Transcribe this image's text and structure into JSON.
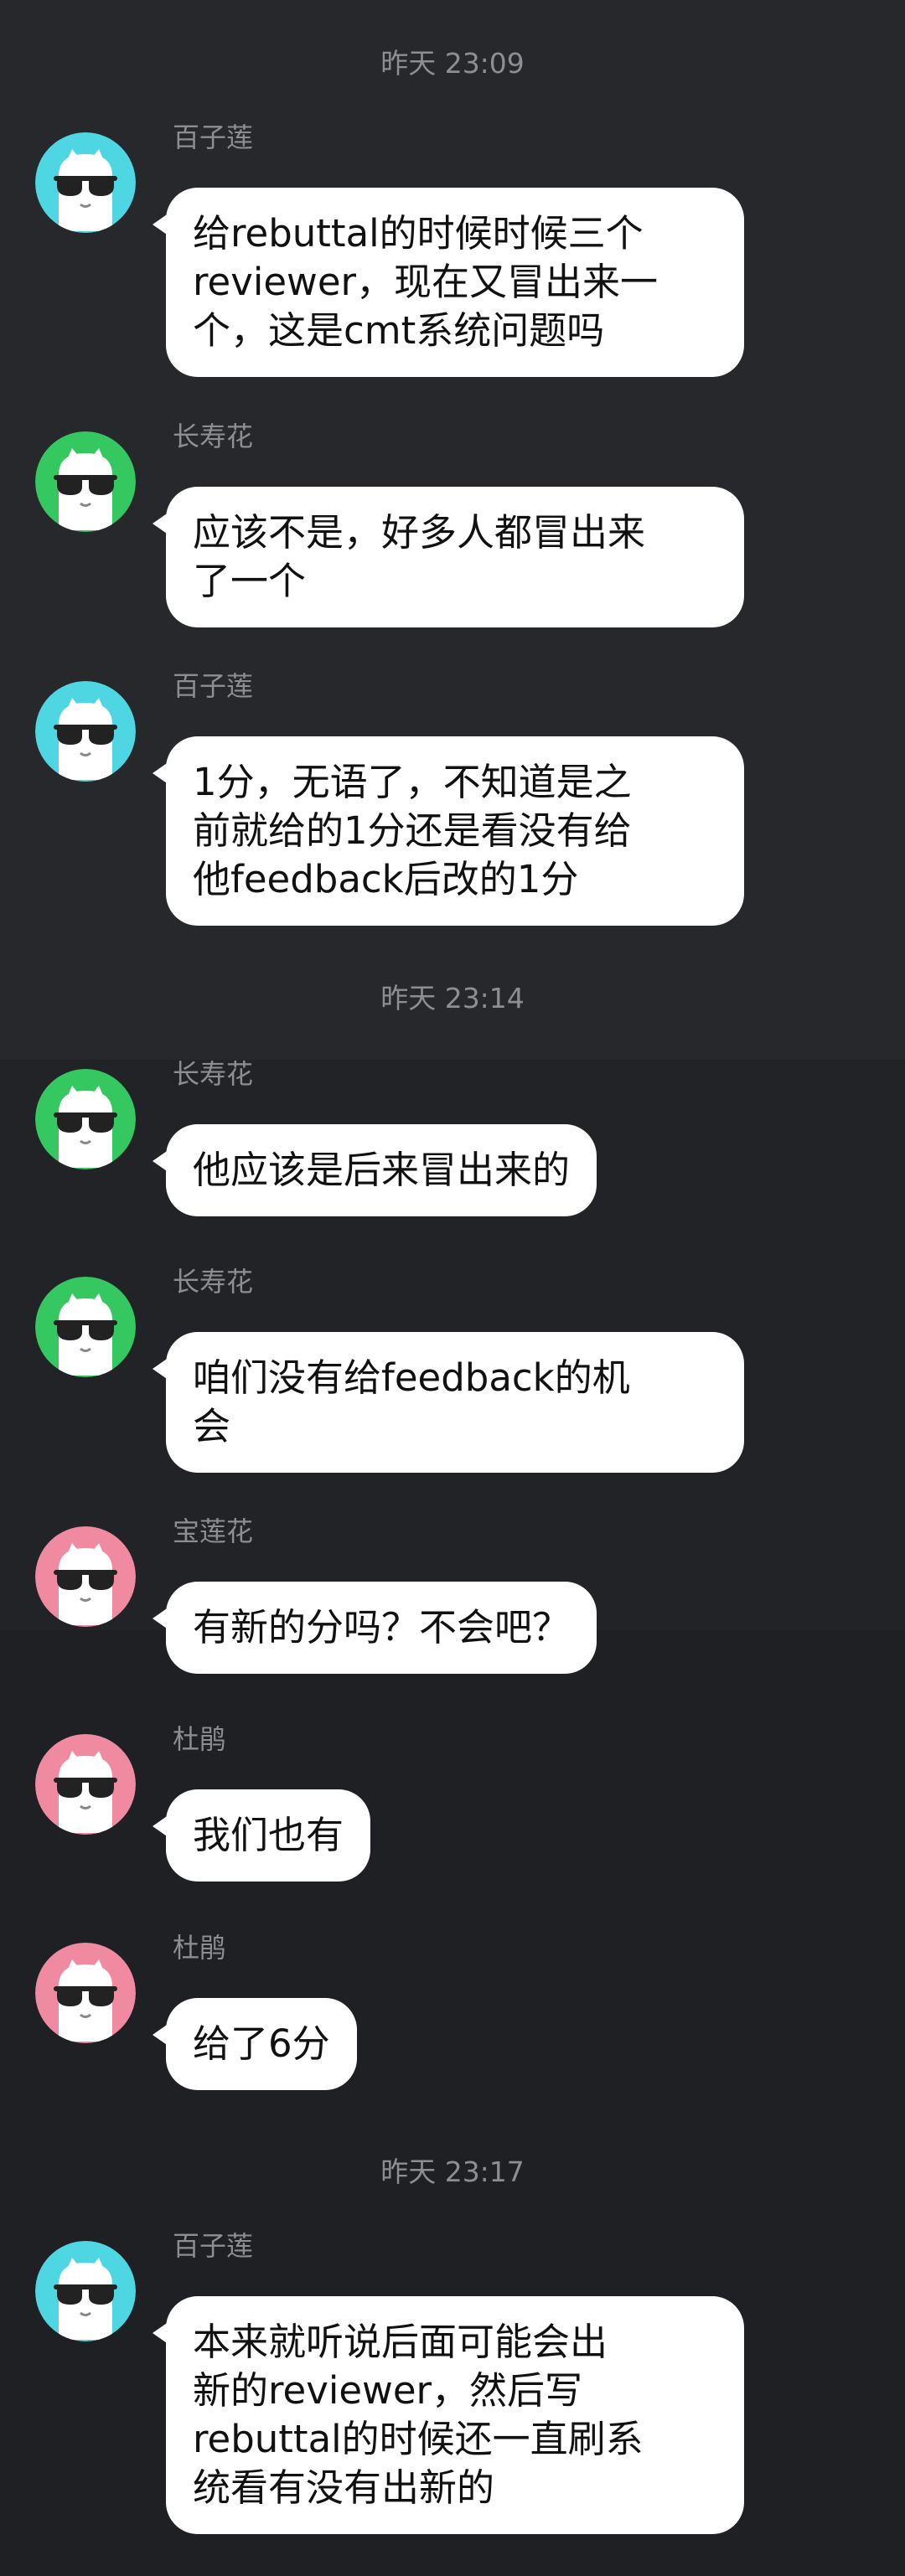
{
  "timestamps": {
    "t1": "昨天 23:09",
    "t2": "昨天 23:14",
    "t3": "昨天 23:17"
  },
  "colors": {
    "avatar_cyan": "#4fd6e3",
    "avatar_green": "#35c760",
    "avatar_pink": "#f08aa0",
    "bubble_bg": "#ffffff",
    "background": "#222327",
    "meta_text": "#8d8e93"
  },
  "messages": [
    {
      "sender": "百子莲",
      "avatar_color": "cyan",
      "text": "给rebuttal的时候时候三个\nreviewer，现在又冒出来一\n个，这是cmt系统问题吗"
    },
    {
      "sender": "长寿花",
      "avatar_color": "green",
      "text": "应该不是，好多人都冒出来\n了一个"
    },
    {
      "sender": "百子莲",
      "avatar_color": "cyan",
      "text": "1分，无语了，不知道是之\n前就给的1分还是看没有给\n他feedback后改的1分"
    },
    {
      "sender": "长寿花",
      "avatar_color": "green",
      "text": "他应该是后来冒出来的"
    },
    {
      "sender": "长寿花",
      "avatar_color": "green",
      "text": "咱们没有给feedback的机\n会"
    },
    {
      "sender": "宝莲花",
      "avatar_color": "pink",
      "text": "有新的分吗？不会吧？"
    },
    {
      "sender": "杜鹃",
      "avatar_color": "pink",
      "text": "我们也有"
    },
    {
      "sender": "杜鹃",
      "avatar_color": "pink",
      "text": "给了6分"
    },
    {
      "sender": "百子莲",
      "avatar_color": "cyan",
      "text": "本来就听说后面可能会出\n新的reviewer，然后写\nrebuttal的时候还一直刷系\n统看有没有出新的"
    }
  ]
}
